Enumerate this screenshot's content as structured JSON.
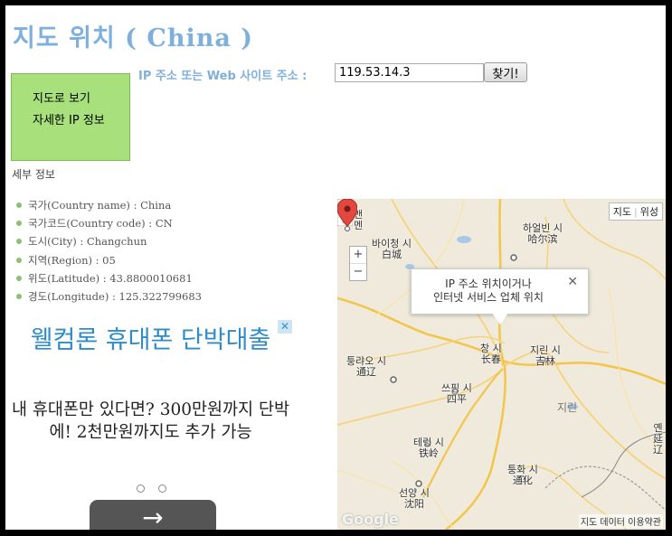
{
  "header": {
    "title_korean": "지도 위치 ",
    "title_latin": "( China )"
  },
  "sidebar": {
    "items": [
      {
        "label": "지도로 보기"
      },
      {
        "label": "자세한 IP 정보"
      }
    ]
  },
  "search": {
    "label": "IP 주소 또는 Web 사이트 주소 :",
    "value": "119.53.14.3",
    "button_label": "찾기!"
  },
  "details": {
    "title": "세부 정보",
    "items": [
      {
        "text": "국가(Country name) : China"
      },
      {
        "text": "국가코드(Country code) : CN"
      },
      {
        "text": "도시(City) : Changchun"
      },
      {
        "text": "지역(Region) : 05"
      },
      {
        "text": "위도(Latitude) : 43.8800010681"
      },
      {
        "text": "경도(Longitude) : 125.322799683"
      }
    ]
  },
  "ad": {
    "title": "웰컴론 휴대폰 단박대출",
    "text": "내 휴대폰만 있다면? 300만원까지 단박에! 2천만원까지도 추가 가능",
    "close_icon": "✕",
    "next_icon": "→"
  },
  "map": {
    "type_map": "지도",
    "type_satellite": "위성",
    "zoom_in": "+",
    "zoom_out": "−",
    "info_window": {
      "line1": "IP 주소 위치이거나",
      "line2": "인터넷 서비스 업체 위치",
      "close": "✕"
    },
    "cities": [
      {
        "name": "맨\n멘"
      },
      {
        "name": "하얼빈 시\n哈尔滨"
      },
      {
        "name": "바이청 시\n白城"
      },
      {
        "name": "창 시\n长春"
      },
      {
        "name": "지린 시\n吉林"
      },
      {
        "name": "퉁랴오 시\n通辽"
      },
      {
        "name": "쓰핑 시\n四平"
      },
      {
        "name": "테링 시\n铁岭"
      },
      {
        "name": "퉁화 시\n通化"
      },
      {
        "name": "선양 시\n沈阳"
      },
      {
        "name": "옌\n延\n辽"
      }
    ],
    "region_label": "지린",
    "logo": "Google",
    "footer": "지도 데이터   이용약관"
  }
}
